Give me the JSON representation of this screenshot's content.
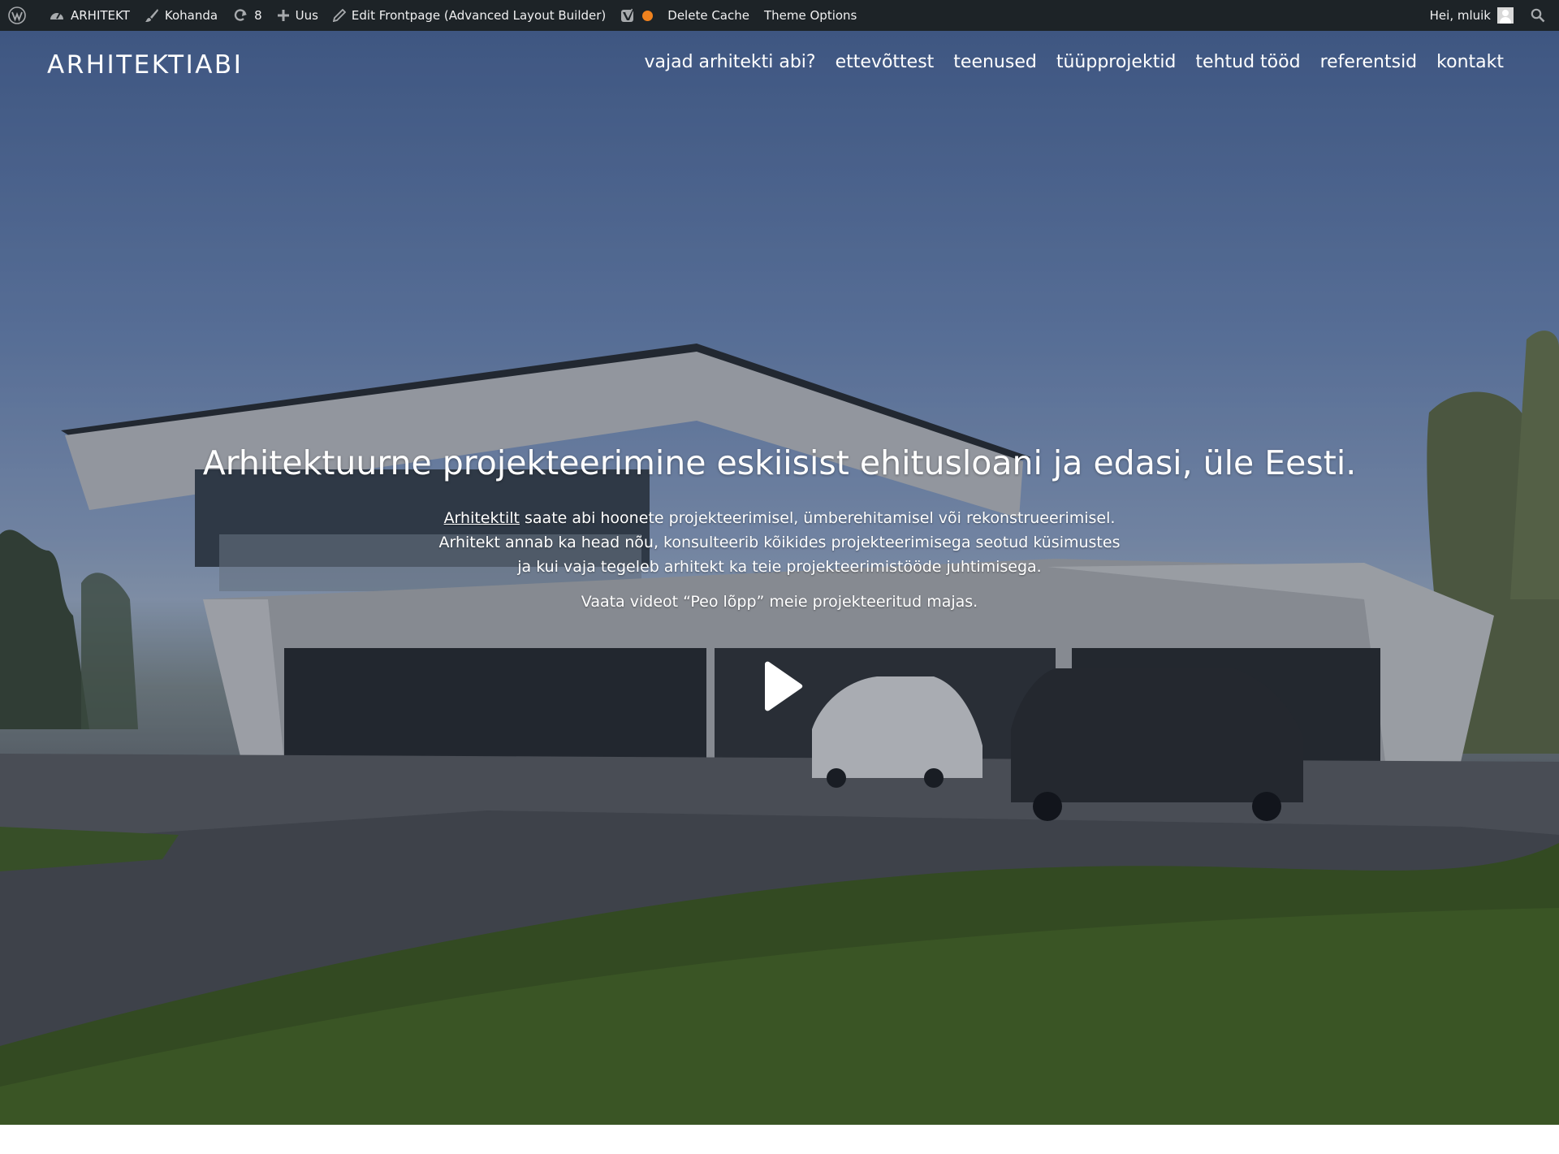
{
  "admin_bar": {
    "site_name": "ARHITEKT",
    "customize": "Kohanda",
    "updates_count": "8",
    "new": "Uus",
    "edit_page": "Edit Frontpage (Advanced Layout Builder)",
    "delete_cache": "Delete Cache",
    "theme_options": "Theme Options",
    "greeting": "Hei, mluik",
    "status_dot_color": "#f0821e",
    "icons": [
      "wordpress-icon",
      "dashboard-icon",
      "brush-icon",
      "refresh-icon",
      "plus-icon",
      "pencil-icon",
      "yoast-icon",
      "status-dot-icon",
      "avatar",
      "search-icon"
    ]
  },
  "header": {
    "logo": "ARHITEKTIABI",
    "nav": [
      {
        "label": "vajad arhitekti abi?"
      },
      {
        "label": "ettevõttest"
      },
      {
        "label": "teenused"
      },
      {
        "label": "tüüpprojektid"
      },
      {
        "label": "tehtud tööd"
      },
      {
        "label": "referentsid"
      },
      {
        "label": "kontakt"
      }
    ]
  },
  "hero": {
    "title": "Arhitektuurne projekteerimine eskiisist ehitusloani ja edasi, üle Eesti.",
    "link_text": "Arhitektilt",
    "line1_rest": " saate abi hoonete projekteerimisel, ümberehitamisel või rekonstrueerimisel.",
    "line2": "Arhitekt annab ka head nõu, konsulteerib kõikides projekteerimisega seotud küsimustes",
    "line3": "ja kui vaja tegeleb arhitekt ka teie projekteerimistööde juhtimisega.",
    "video_note": "Vaata videot “Peo lõpp” meie projekteeritud majas.",
    "play_icon": "play-icon"
  }
}
